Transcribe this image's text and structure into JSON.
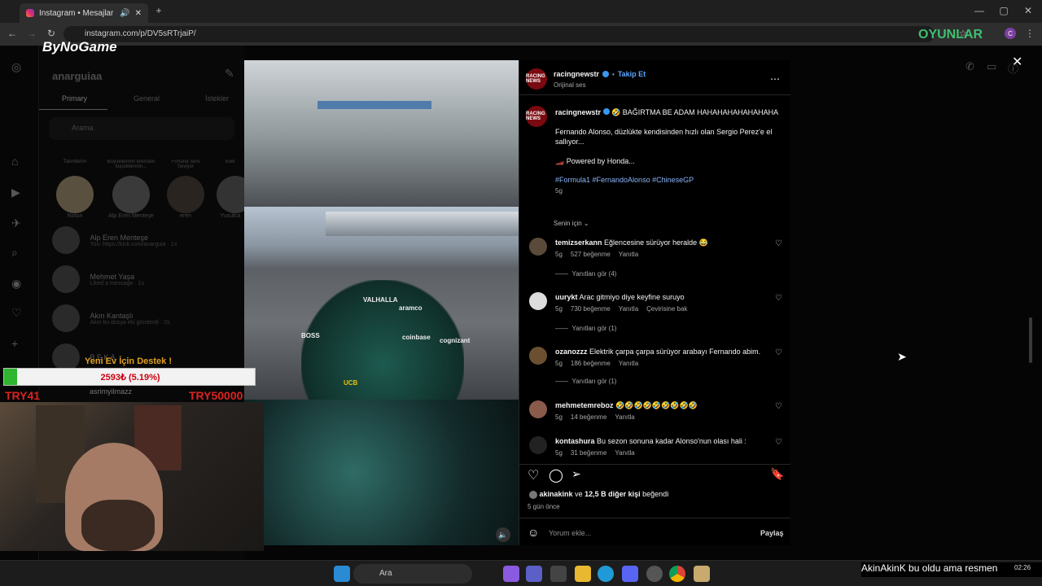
{
  "browser": {
    "tab_title": "Instagram • Mesajlar",
    "url": "instagram.com/p/DV5sRTrjaiP/",
    "profile_letter": "C"
  },
  "overlay": {
    "logo": "ByNoGame",
    "watermark": "OYUNLAR",
    "donation_title": "Yeni Ev İçin Destek !",
    "donation_value": "2593₺ (5.19%)",
    "donation_progress": 0.0519,
    "donation_min": "TRY41",
    "donation_max": "TRY50000",
    "ticker": "AkinAkinK bu oldu ama resmen"
  },
  "dm": {
    "username": "anarguiaa",
    "tabs": [
      "Primary",
      "General",
      "İstekler"
    ],
    "search_placeholder": "Arama",
    "notes": [
      {
        "title": "Takmilerim",
        "name": "Notun"
      },
      {
        "title": "Büyüklerimin elleriden küçüklerimin...",
        "name": "Alp Eren Menteşe"
      },
      {
        "title": "Fortuna Seni Seviyor",
        "name": "eren"
      },
      {
        "title": "Eller",
        "name": "Yusufca"
      }
    ],
    "threads": [
      {
        "name": "Alp Eren Menteşe",
        "preview": "You: https://kick.com/anarguia · 1s"
      },
      {
        "name": "Mehmet Yaşa",
        "preview": "Liked a message · 1s"
      },
      {
        "name": "Akın Kantaşlı",
        "preview": "Akın bu dosya eki gönderdi · 2s"
      },
      {
        "name": "B E K A",
        "preview": ""
      },
      {
        "name": "asrimyilmazz",
        "preview": ""
      }
    ]
  },
  "video": {
    "labels": [
      "VALHALLA",
      "aramco",
      "BOSS",
      "cognizant",
      "UCB",
      "coinbase"
    ]
  },
  "post": {
    "author": "racingnewstr",
    "follow": "Takip Et",
    "audio": "Orijinal ses",
    "avatar_text": "RACING NEWS",
    "caption_line1": "🤣 BAĞIRTMA BE ADAM HAHAHAHAHAHAHAHA",
    "caption_line2": "Fernando Alonso, düzlükte kendisinden hızlı olan Sergio Perez'e el sallıyor...",
    "caption_line3": "🏎️ Powered by Honda...",
    "hashtags": "#Formula1 #FernandoAlonso #ChineseGP",
    "age": "5g",
    "sort": "Senin için",
    "comments": [
      {
        "user": "temizserkann",
        "text": "Eğlencesine sürüyor heralde 😂",
        "age": "5g",
        "likes": "527 beğenme",
        "reply": "Yanıtla",
        "extra": "",
        "replies": "Yanıtları gör (4)"
      },
      {
        "user": "uurykt",
        "text": "Arac gitmiyo diye keyfine suruyo",
        "age": "5g",
        "likes": "730 beğenme",
        "reply": "Yanıtla",
        "extra": "Çevirisine bak",
        "replies": "Yanıtları gör (1)"
      },
      {
        "user": "ozanozzz",
        "text": "Elektrik çarpa çarpa sürüyor arabayı Fernando abim.",
        "age": "5g",
        "likes": "186 beğenme",
        "reply": "Yanıtla",
        "extra": "",
        "replies": "Yanıtları gör (1)"
      },
      {
        "user": "mehmetemreboz",
        "text": "🤣🤣🤣🤣🤣🤣🤣🤣🤣",
        "age": "5g",
        "likes": "14 beğenme",
        "reply": "Yanıtla",
        "extra": "",
        "replies": ""
      },
      {
        "user": "kontashura",
        "text": "Bu sezon sonuna kadar Alonso'nun olası hali :",
        "age": "5g",
        "likes": "31 beğenme",
        "reply": "Yanıtla",
        "extra": "",
        "replies": ""
      }
    ],
    "liked_by_user": "akinakink",
    "liked_by_rest": "ve",
    "liked_by_count": "12,5 B diğer kişi",
    "liked_by_suffix": "beğendi",
    "date": "5 gün önce",
    "comment_placeholder": "Yorum ekle...",
    "share": "Paylaş"
  },
  "taskbar": {
    "search": "Ara",
    "time": "02:26"
  }
}
